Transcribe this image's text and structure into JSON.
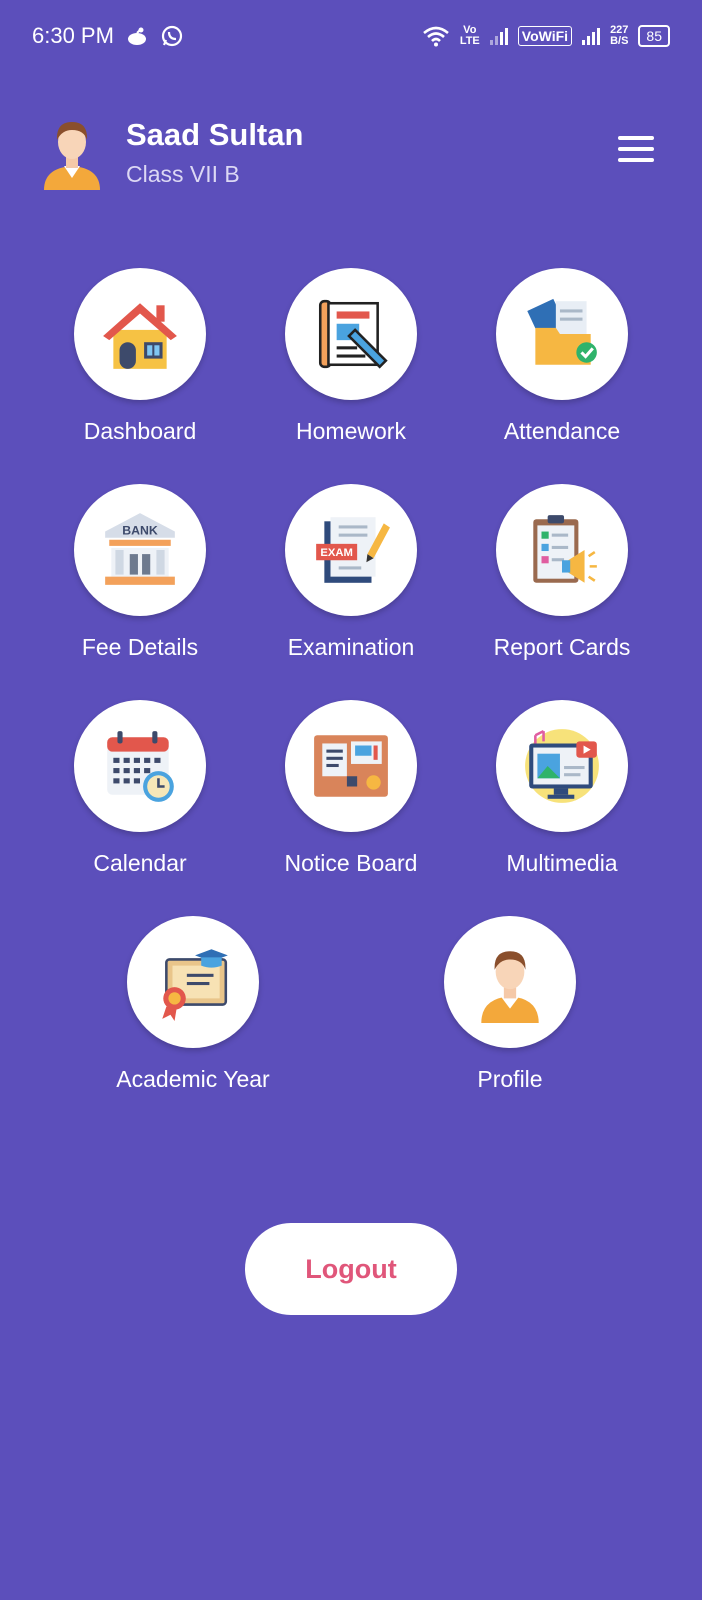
{
  "status_bar": {
    "time": "6:30 PM",
    "network_tag_top": "Vo",
    "network_tag_bottom": "LTE",
    "vowifi": "VoWiFi",
    "speed_top": "227",
    "speed_bottom": "B/S",
    "battery": "85"
  },
  "header": {
    "name": "Saad Sultan",
    "class": "Class VII B"
  },
  "menu": [
    {
      "label": "Dashboard",
      "icon": "house-icon"
    },
    {
      "label": "Homework",
      "icon": "homework-icon"
    },
    {
      "label": "Attendance",
      "icon": "attendance-folder-icon"
    },
    {
      "label": "Fee Details",
      "icon": "bank-icon"
    },
    {
      "label": "Examination",
      "icon": "exam-icon"
    },
    {
      "label": "Report Cards",
      "icon": "report-clipboard-icon"
    },
    {
      "label": "Calendar",
      "icon": "calendar-clock-icon"
    },
    {
      "label": "Notice Board",
      "icon": "notice-board-icon"
    },
    {
      "label": "Multimedia",
      "icon": "multimedia-monitor-icon"
    },
    {
      "label": "Academic Year",
      "icon": "certificate-icon"
    },
    {
      "label": "Profile",
      "icon": "person-icon"
    }
  ],
  "bank_sign": "BANK",
  "exam_sign": "EXAM",
  "logout_label": "Logout",
  "colors": {
    "background": "#5c4fbb",
    "logout_text": "#e0567a"
  }
}
